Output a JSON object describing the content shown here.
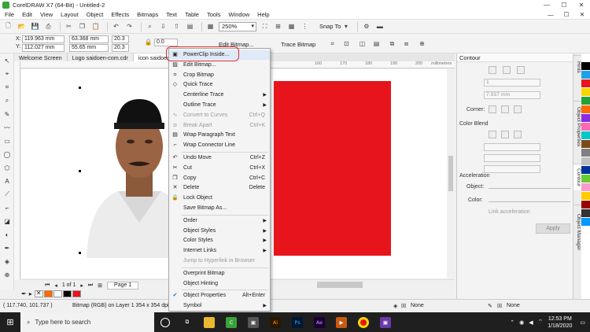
{
  "window": {
    "title": "CorelDRAW X7 (64-Bit) - Untitled-2",
    "minimize": "—",
    "maximize": "☐",
    "close": "✕"
  },
  "menu": [
    "File",
    "Edit",
    "View",
    "Layout",
    "Object",
    "Effects",
    "Bitmaps",
    "Text",
    "Table",
    "Tools",
    "Window",
    "Help"
  ],
  "toolbar": {
    "zoom": "250%",
    "snap_label": "Snap To"
  },
  "props": {
    "x_label": "X:",
    "x": "119.963 mm",
    "y_label": "Y:",
    "y": "112.027 mm",
    "w": "63.368 mm",
    "h": "55.65 mm",
    "sx": "20.3",
    "sy": "20.3",
    "rotation": "0.0",
    "edit_bitmap": "Edit Bitmap...",
    "trace_bitmap": "Trace Bitmap"
  },
  "doc_tabs": [
    "Welcome Screen",
    "Logo saidoen-com.cdr",
    "icon saidoen-c..."
  ],
  "ruler": {
    "ticks": [
      "160",
      "170",
      "180",
      "190",
      "200"
    ],
    "unit": "millimeters"
  },
  "page_nav": {
    "count": "1 of 1",
    "page_tab": "Page 1"
  },
  "context_menu": [
    {
      "label": "PowerClip Inside...",
      "icon": "powerclip-icon",
      "state": "normal"
    },
    {
      "label": "Edit Bitmap...",
      "icon": "edit-bitmap-icon",
      "state": "normal"
    },
    {
      "label": "Crop Bitmap",
      "icon": "crop-icon",
      "state": "normal"
    },
    {
      "label": "Quick Trace",
      "icon": "trace-icon",
      "state": "normal"
    },
    {
      "label": "Centerline Trace",
      "icon": "",
      "state": "submenu"
    },
    {
      "label": "Outline Trace",
      "icon": "",
      "state": "submenu"
    },
    {
      "label": "Convert to Curves",
      "icon": "curves-icon",
      "shortcut": "Ctrl+Q",
      "state": "disabled"
    },
    {
      "label": "Break Apart",
      "icon": "break-icon",
      "shortcut": "Ctrl+K",
      "state": "disabled"
    },
    {
      "label": "Wrap Paragraph Text",
      "icon": "wrap-icon",
      "state": "normal"
    },
    {
      "label": "Wrap Connector Line",
      "icon": "connector-icon",
      "state": "normal"
    },
    {
      "label": "Undo Move",
      "icon": "undo-icon",
      "shortcut": "Ctrl+Z",
      "state": "normal"
    },
    {
      "label": "Cut",
      "icon": "cut-icon",
      "shortcut": "Ctrl+X",
      "state": "normal"
    },
    {
      "label": "Copy",
      "icon": "copy-icon",
      "shortcut": "Ctrl+C",
      "state": "normal"
    },
    {
      "label": "Delete",
      "icon": "delete-icon",
      "shortcut": "Delete",
      "state": "normal"
    },
    {
      "label": "Lock Object",
      "icon": "lock-icon",
      "state": "normal"
    },
    {
      "label": "Save Bitmap As...",
      "icon": "",
      "state": "normal"
    },
    {
      "label": "Order",
      "icon": "",
      "state": "submenu"
    },
    {
      "label": "Object Styles",
      "icon": "",
      "state": "submenu"
    },
    {
      "label": "Color Styles",
      "icon": "",
      "state": "submenu"
    },
    {
      "label": "Internet Links",
      "icon": "",
      "state": "submenu"
    },
    {
      "label": "Jump to Hyperlink in Browser",
      "icon": "",
      "state": "disabled"
    },
    {
      "label": "Overprint Bitmap",
      "icon": "",
      "state": "normal"
    },
    {
      "label": "Object Hinting",
      "icon": "",
      "state": "normal"
    },
    {
      "label": "Object Properties",
      "icon": "check-icon",
      "shortcut": "Alt+Enter",
      "state": "normal"
    },
    {
      "label": "Symbol",
      "icon": "",
      "state": "submenu"
    }
  ],
  "contour": {
    "title": "Contour",
    "steps": "1",
    "offset": "7.937 mm",
    "corner": "Corner:",
    "color_blend": "Color Blend",
    "acceleration": "Acceleration",
    "object": "Object:",
    "color": "Color:",
    "link_accel": "Link acceleration",
    "apply": "Apply"
  },
  "dock_tabs": [
    "Hints",
    "Object Properties",
    "Contour",
    "Object Manager"
  ],
  "status": {
    "coords": "( 117.740, 101.737 )",
    "info": "Bitmap (RGB) on Layer 1 354 x 354 dpi",
    "fill": "None",
    "outline": "None"
  },
  "taskbar": {
    "search": "Type here to search",
    "time": "12:53 PM",
    "date": "1/18/2020"
  },
  "colors": {
    "accent_red": "#e8141c",
    "highlight": "#d93030",
    "palette": [
      "#ffffff",
      "#000000",
      "#1aa3e8",
      "#e8141c",
      "#f5d800",
      "#22a33a",
      "#ff6a00",
      "#8a2be2",
      "#ff69b4",
      "#00c8c8",
      "#7a4a1a",
      "#808080",
      "#c0c0c0",
      "#003399",
      "#66cc33",
      "#ff99cc",
      "#ffcc00",
      "#990000",
      "#333333",
      "#0099ff"
    ]
  }
}
